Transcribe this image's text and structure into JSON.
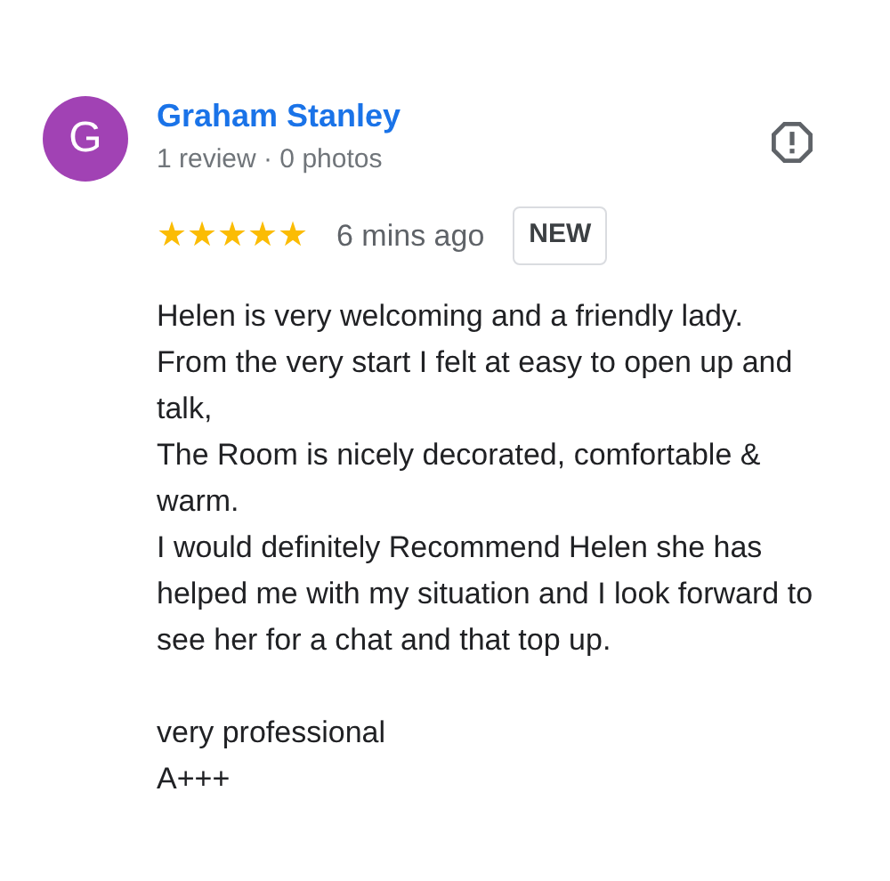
{
  "review": {
    "avatar_letter": "G",
    "author": "Graham Stanley",
    "meta": "1 review · 0 photos",
    "stars": 5,
    "time": "6 mins ago",
    "badge": "NEW",
    "body": [
      "Helen is very welcoming and a friendly lady. From the very start I felt at easy to open up and talk,",
      "The Room is nicely decorated, comfortable & warm.",
      "I would definitely Recommend Helen she has helped me with my situation and I look forward to see her for a chat and that top up."
    ],
    "closing": [
      "very professional",
      "A+++"
    ]
  }
}
